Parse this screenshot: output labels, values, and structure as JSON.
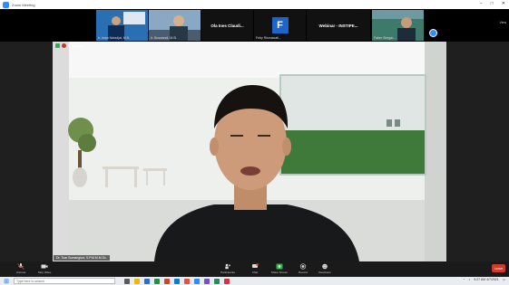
{
  "window": {
    "title": "Zoom Meeting",
    "controls": [
      "–",
      "□",
      "✕"
    ]
  },
  "strip": {
    "view_label": "View",
    "tiles": [
      {
        "name": "Ir. Iman Ndradjat, M.S."
      },
      {
        "name": "Ir. Ruswandi, M.Si."
      },
      {
        "name": "Ola Ines Claudia",
        "center": "Ola Ines Claudi..."
      },
      {
        "name": "Feby Rismawati...",
        "letter": "F"
      },
      {
        "name": "",
        "center": "Webinar - INSTIPE..."
      },
      {
        "name": "Faber Siregar..."
      }
    ]
  },
  "video": {
    "rec_label": "Recording",
    "speaker_name": "Dr. Toar Sumangkut, S.P.M.M.M.Sc."
  },
  "toolbar": {
    "left": [
      {
        "label": "Unmute",
        "icon": "mic-icon"
      },
      {
        "label": "Stop Video",
        "icon": "video-icon"
      }
    ],
    "center": [
      {
        "label": "Participants",
        "icon": "participants-icon"
      },
      {
        "label": "Chat",
        "icon": "chat-icon"
      },
      {
        "label": "Share Screen",
        "icon": "share-icon"
      },
      {
        "label": "Record",
        "icon": "record-icon"
      },
      {
        "label": "Reactions",
        "icon": "reactions-icon"
      }
    ],
    "end_label": "Leave"
  },
  "taskbar": {
    "search_placeholder": "Type here to search",
    "clock_time": "9:27 AM",
    "clock_date": "4/7/2021"
  }
}
